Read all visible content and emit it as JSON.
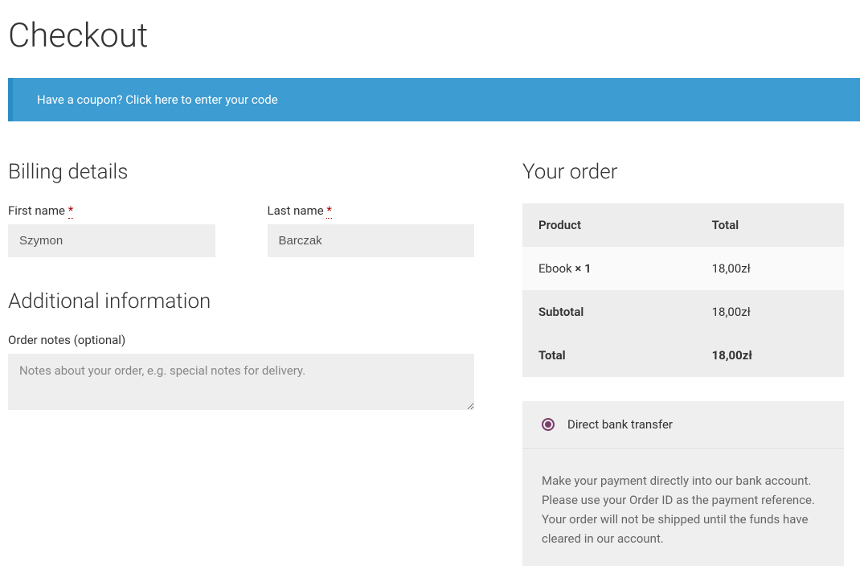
{
  "page_title": "Checkout",
  "coupon_banner": {
    "prompt": "Have a coupon? ",
    "link": "Click here to enter your code"
  },
  "billing": {
    "heading": "Billing details",
    "first_name_label": "First name",
    "first_name_value": "Szymon",
    "last_name_label": "Last name",
    "last_name_value": "Barczak",
    "required_star": "*"
  },
  "additional": {
    "heading": "Additional information",
    "notes_label": "Order notes (optional)",
    "notes_placeholder": "Notes about your order, e.g. special notes for delivery."
  },
  "order": {
    "heading": "Your order",
    "columns": {
      "product": "Product",
      "total": "Total"
    },
    "line_item": {
      "name": "Ebook  ",
      "qty": "× 1",
      "total": "18,00zł"
    },
    "subtotal": {
      "label": "Subtotal",
      "value": "18,00zł"
    },
    "total": {
      "label": "Total",
      "value": "18,00zł"
    }
  },
  "payment": {
    "method_label": "Direct bank transfer",
    "description": "Make your payment directly into our bank account. Please use your Order ID as the payment reference. Your order will not be shipped until the funds have cleared in our account."
  }
}
